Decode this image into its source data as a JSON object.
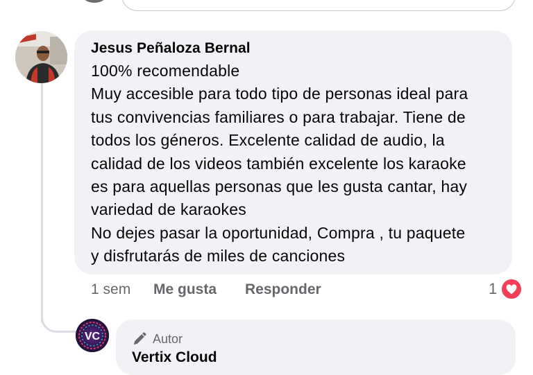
{
  "comment": {
    "author": "Jesus Peñaloza Bernal",
    "text": "100% recomendable\nMuy accesible para todo tipo de personas ideal para\ntus convivencias familiares o para trabajar. Tiene de\ntodos los géneros. Excelente calidad de audio, la\ncalidad de los videos también excelente los karaoke\nes para aquellas personas que les gusta cantar, hay\nvariedad de karaokes\nNo dejes pasar la oportunidad, Compra , tu paquete\ny disfrutarás de miles de canciones",
    "time": "1 sem",
    "like_label": "Me gusta",
    "reply_label": "Responder",
    "reaction_count": "1",
    "reaction_icon": "heart-icon"
  },
  "reply": {
    "badge": "Autor",
    "badge_icon": "pencil-icon",
    "avatar_initials": "VC",
    "author": "Vertix Cloud"
  },
  "colors": {
    "bubble": "#f0f2f5",
    "muted_text": "#65676b",
    "heart": "#f33e58",
    "thread_line": "#dadde1"
  }
}
